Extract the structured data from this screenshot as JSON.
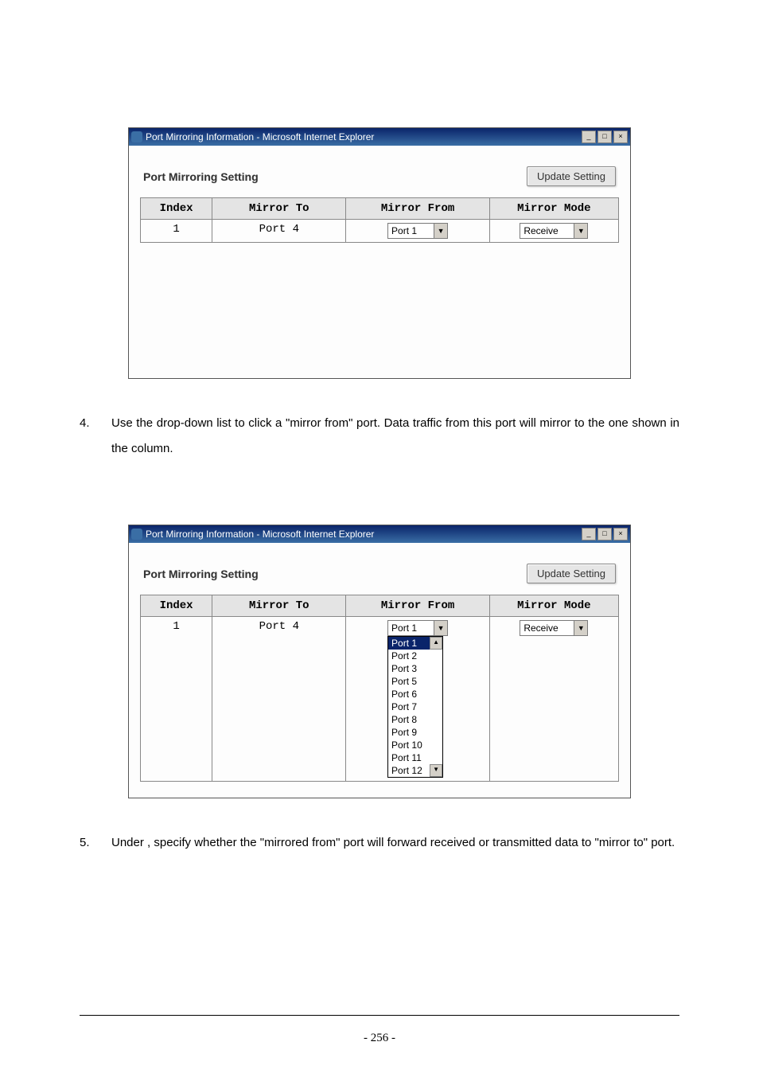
{
  "window": {
    "title": "Port Mirroring Information - Microsoft Internet Explorer",
    "min": "_",
    "max": "□",
    "close": "×"
  },
  "settingTitle": "Port Mirroring Setting",
  "updateBtn": "Update Setting",
  "headers": {
    "index": "Index",
    "mirrorTo": "Mirror To",
    "mirrorFrom": "Mirror From",
    "mirrorMode": "Mirror Mode"
  },
  "row": {
    "index": "1",
    "mirrorTo": "Port 4",
    "mirrorFromSelected": "Port 1",
    "mirrorModeSelected": "Receive"
  },
  "dropdownOptions": [
    "Port 1",
    "Port 2",
    "Port 3",
    "Port 5",
    "Port 6",
    "Port 7",
    "Port 8",
    "Port 9",
    "Port 10",
    "Port 11",
    "Port 12"
  ],
  "step4": {
    "num": "4.",
    "text": "Use the                        drop-down list to click a \"mirror from\" port. Data traffic from this port will mirror to the one shown in the                        column."
  },
  "step5": {
    "num": "5.",
    "text": "Under                             , specify whether the \"mirrored from\" port will forward received or transmitted data to \"mirror to\" port."
  },
  "pageNumber": "- 256 -"
}
